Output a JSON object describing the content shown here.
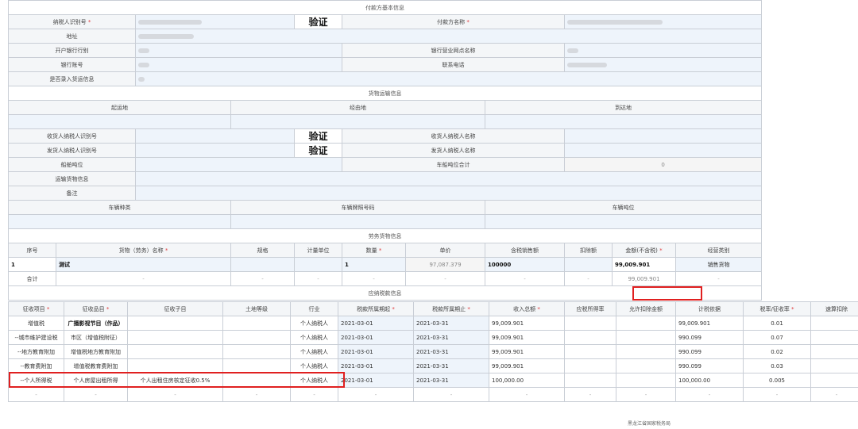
{
  "payer_section": {
    "title": "付款方基本信息",
    "taxpayer_id_label": "纳税人识别号",
    "verify": "验证",
    "payer_name_label": "付款方名称",
    "address_label": "地址",
    "bank_label": "开户银行行别",
    "bank_branch_label": "银行营业网点名称",
    "account_label": "银行账号",
    "phone_label": "联系电话",
    "goods_entry_label": "是否录入货运信息"
  },
  "transport": {
    "title": "货物运输信息",
    "origin": "起运地",
    "via": "经由地",
    "destination": "到达地",
    "receiver_id_label": "收货人纳税人识别号",
    "receiver_name_label": "收货人纳税人名称",
    "shipper_id_label": "发货人纳税人识别号",
    "shipper_name_label": "发货人纳税人名称",
    "ship_tonnage_label": "船舶吨位",
    "vehicle_tonnage_total_label": "车船吨位合计",
    "vehicle_tonnage_total": "0",
    "cargo_info_label": "运输货物信息",
    "remark_label": "备注",
    "vehicle_type": "车辆种类",
    "plate_no": "车辆牌照号码",
    "vehicle_tonnage": "车辆吨位"
  },
  "services": {
    "title": "劳务货物信息",
    "headers": {
      "seq": "序号",
      "name": "货物（劳务）名称",
      "spec": "规格",
      "unit": "计量单位",
      "qty": "数量",
      "price": "单价",
      "tax_inc": "含税销售额",
      "deduct": "扣除额",
      "amount": "金额(不含税)",
      "category": "经营类别"
    },
    "row": {
      "seq": "1",
      "name": "测试",
      "qty": "1",
      "price": "97,087.379",
      "tax_inc": "100000",
      "amount": "99,009.901",
      "category": "销售货物"
    },
    "total_label": "合计",
    "total_amount": "99,009.901",
    "dash": "-"
  },
  "tax_info": {
    "title": "应纳税款信息",
    "headers": [
      "征收项目",
      "征收品目",
      "征收子目",
      "土地等级",
      "行业",
      "税款所属期起",
      "税款所属期止",
      "收入总额",
      "应税所得率",
      "允许扣除金额",
      "计税依据",
      "税率/征收率",
      "速算扣除"
    ],
    "required": [
      true,
      true,
      false,
      false,
      false,
      true,
      true,
      true,
      false,
      false,
      false,
      true,
      false
    ],
    "rows": [
      {
        "item": "增值税",
        "sub": "广播影视节目（作品）",
        "subsub": "",
        "industry": "个人纳税人",
        "from": "2021-03-01",
        "to": "2021-03-31",
        "income": "99,009.901",
        "basis": "99,009.901",
        "rate": "0.01"
      },
      {
        "item": "--城市维护建设税",
        "sub": "市区（增值税附征）",
        "subsub": "",
        "industry": "个人纳税人",
        "from": "2021-03-01",
        "to": "2021-03-31",
        "income": "99,009.901",
        "basis": "990.099",
        "rate": "0.07"
      },
      {
        "item": "--地方教育附加",
        "sub": "增值税地方教育附加",
        "subsub": "",
        "industry": "个人纳税人",
        "from": "2021-03-01",
        "to": "2021-03-31",
        "income": "99,009.901",
        "basis": "990.099",
        "rate": "0.02"
      },
      {
        "item": "--教育费附加",
        "sub": "增值税教育费附加",
        "subsub": "",
        "industry": "个人纳税人",
        "from": "2021-03-01",
        "to": "2021-03-31",
        "income": "99,009.901",
        "basis": "990.099",
        "rate": "0.03"
      },
      {
        "item": "--个人所得税",
        "sub": "个人房屋出租所得",
        "subsub": "个人出租住房核定征收0.5%",
        "industry": "个人纳税人",
        "from": "2021-03-01",
        "to": "2021-03-31",
        "income": "100,000.00",
        "basis": "100,000.00",
        "rate": "0.005"
      }
    ]
  },
  "footer": "黑龙江省国家税务局"
}
